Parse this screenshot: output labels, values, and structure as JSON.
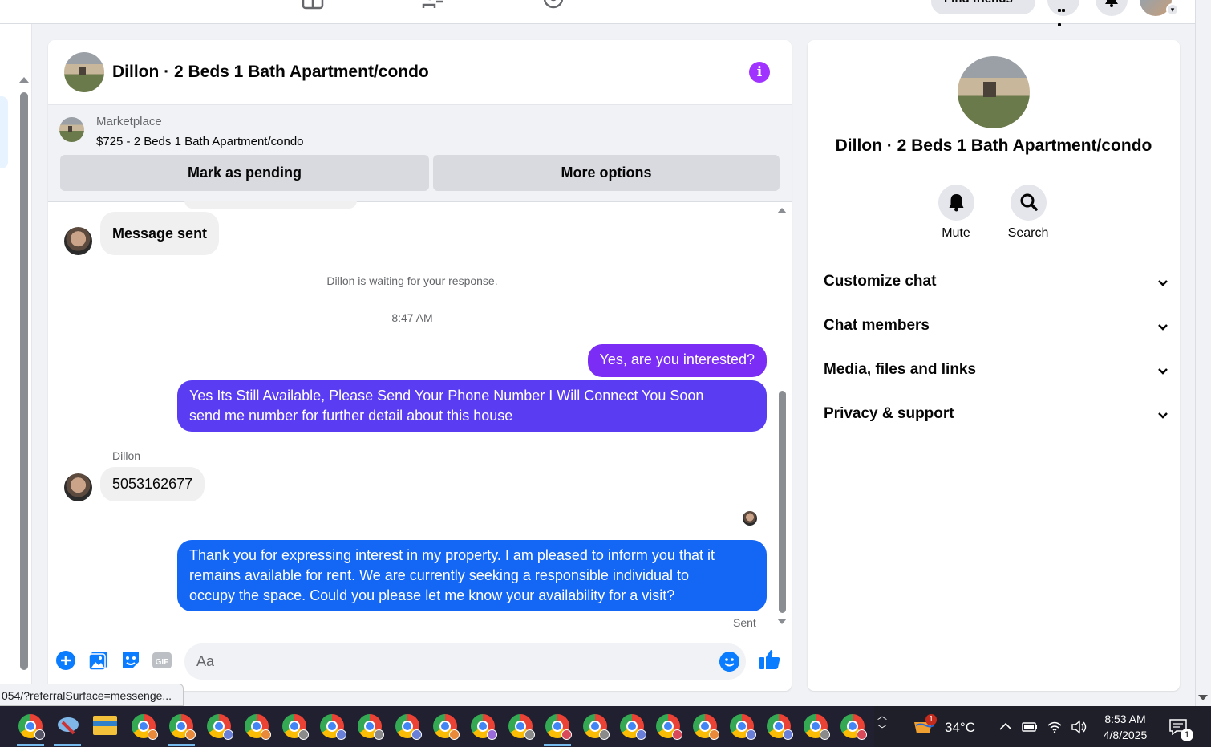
{
  "topbar": {
    "find_friends": "Find friends"
  },
  "chat": {
    "title": "Dillon · 2 Beds 1 Bath Apartment/condo",
    "info_icon": "info-icon",
    "marketplace": {
      "label": "Marketplace",
      "listing": "$725 - 2 Beds 1 Bath Apartment/condo",
      "mark_pending": "Mark as pending",
      "more_options": "More options"
    },
    "messages": {
      "msg1": "Message sent",
      "waiting": "Dillon is waiting for your response.",
      "time": "8:47 AM",
      "out1": "Yes, are you interested?",
      "out2_line1": "Yes Its Still Available, Please Send Your Phone Number I Will Connect You Soon",
      "out2_line2": "send me number for further detail about this house",
      "sender": "Dillon",
      "in2": "5053162677",
      "out3_line1": "Thank you for expressing interest in my property. I am pleased to inform you that it",
      "out3_line2": "remains available for rent. We are currently seeking a responsible individual to",
      "out3_line3": "occupy the space. Could you please let me know your availability for a visit?",
      "sent_status": "Sent"
    },
    "composer": {
      "placeholder": "Aa"
    },
    "colors": {
      "purple_bubble": "#7b2cf5",
      "indigo_bubble": "#5a3cf2",
      "blue_bubble": "#1466f5",
      "accent": "#0a7cff"
    }
  },
  "side": {
    "title": "Dillon · 2 Beds 1 Bath Apartment/condo",
    "mute": "Mute",
    "search": "Search",
    "rows": [
      "Customize chat",
      "Chat members",
      "Media, files and links",
      "Privacy & support"
    ]
  },
  "status_url": "054/?referralSurface=messenge...",
  "taskbar": {
    "temperature": "34°C",
    "time": "8:53 AM",
    "date": "4/8/2025",
    "weather_badge": "1",
    "notification_count": "1"
  }
}
